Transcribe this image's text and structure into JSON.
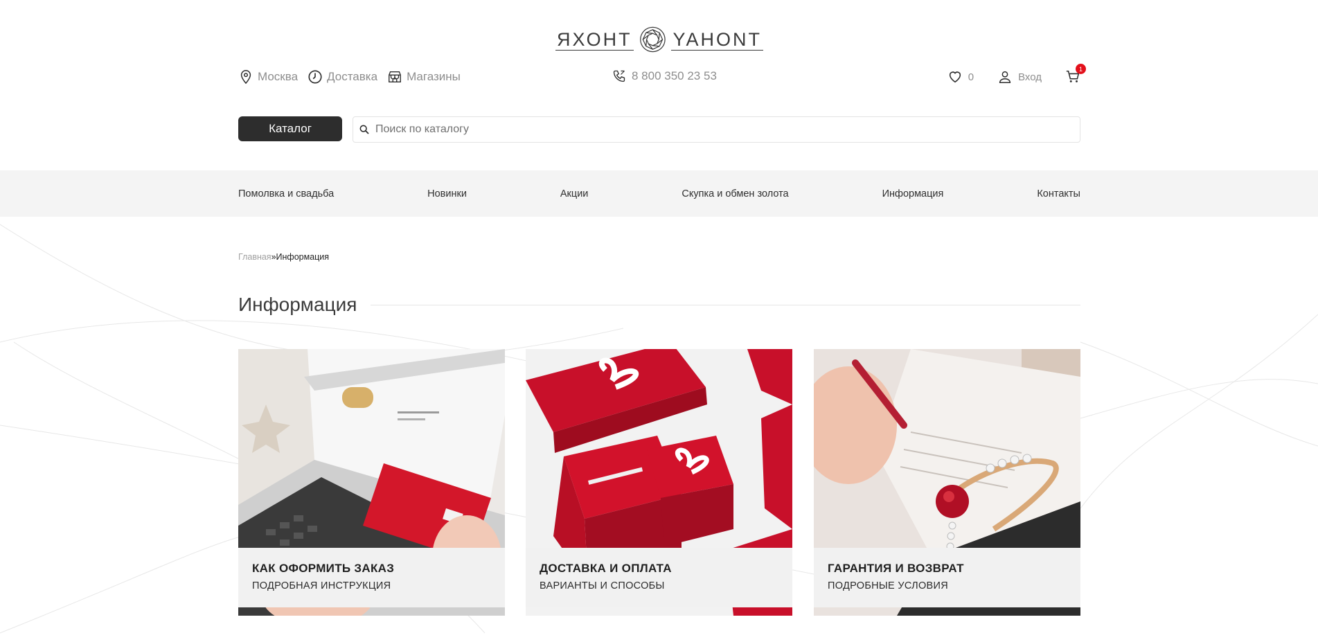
{
  "logo": {
    "left_word": "ЯХОНТ",
    "right_word": "YAHONT"
  },
  "topbar": {
    "city": "Москва",
    "delivery": "Доставка",
    "stores": "Магазины",
    "phone": "8 800 350 23 53",
    "favorites_count": "0",
    "login": "Вход",
    "cart_count": "1"
  },
  "search": {
    "catalog_button": "Каталог",
    "placeholder": "Поиск по каталогу"
  },
  "nav": {
    "items": [
      {
        "label": "Помолвка и свадьба"
      },
      {
        "label": "Новинки"
      },
      {
        "label": "Акции"
      },
      {
        "label": "Скупка и обмен золота"
      },
      {
        "label": "Информация"
      },
      {
        "label": "Контакты"
      }
    ]
  },
  "breadcrumb": {
    "home": "Главная",
    "separator": "»",
    "current": "Информация"
  },
  "page": {
    "title": "Информация"
  },
  "cards": [
    {
      "title": "КАК ОФОРМИТЬ ЗАКАЗ",
      "subtitle": "ПОДРОБНАЯ ИНСТРУКЦИЯ",
      "image": "laptop-with-card"
    },
    {
      "title": "ДОСТАВКА И ОПЛАТА",
      "subtitle": "ВАРИАНТЫ И СПОСОБЫ",
      "image": "red-gift-boxes"
    },
    {
      "title": "ГАРАНТИЯ И ВОЗВРАТ",
      "subtitle": "ПОДРОБНЫЕ УСЛОВИЯ",
      "image": "ruby-ring"
    }
  ],
  "colors": {
    "accent_dark": "#2d2d2d",
    "badge_red": "#e3101b",
    "nav_bg": "#f4f4f4",
    "text_muted": "#8d8d8d"
  }
}
